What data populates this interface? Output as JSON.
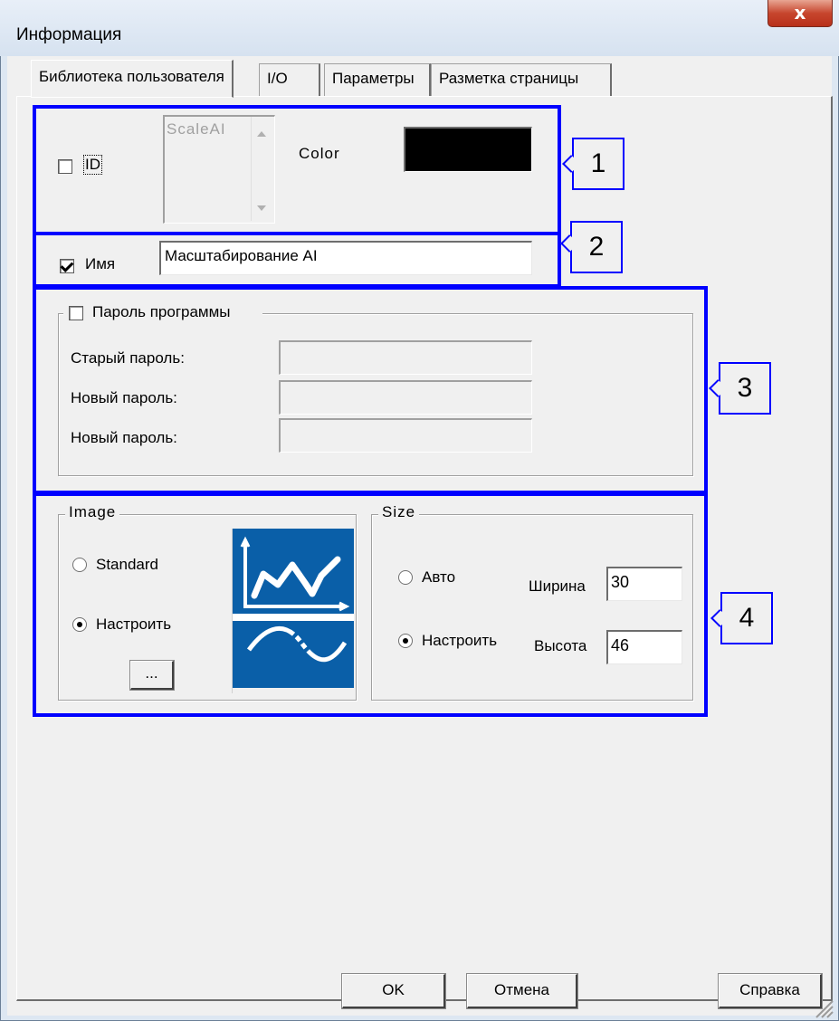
{
  "window": {
    "title": "Информация",
    "close_glyph": "x"
  },
  "tabs": [
    {
      "label": "Библиотека пользователя"
    },
    {
      "label": "I/O"
    },
    {
      "label": "Параметры"
    },
    {
      "label": "Разметка страницы"
    }
  ],
  "callouts": [
    "1",
    "2",
    "3",
    "4"
  ],
  "section_id": {
    "id_label": "ID",
    "id_checked": false,
    "list_items": [
      "ScaleAI"
    ],
    "color_label": "Color",
    "color_value": "#000000"
  },
  "section_name": {
    "name_label": "Имя",
    "name_checked": true,
    "name_value": "Масштабирование AI"
  },
  "section_password": {
    "group_label": "Пароль программы",
    "group_checked": false,
    "old_password_label": "Старый пароль:",
    "new_password_label": "Новый пароль:",
    "confirm_password_label": "Новый пароль:"
  },
  "section_image": {
    "group_label": "Image",
    "standard_label": "Standard",
    "custom_label": "Настроить",
    "selected": "custom",
    "browse_label": "...",
    "preview_bg": "#0a5fa8"
  },
  "section_size": {
    "group_label": "Size",
    "auto_label": "Авто",
    "custom_label": "Настроить",
    "selected": "custom",
    "width_label": "Ширина",
    "width_value": "30",
    "height_label": "Высота",
    "height_value": "46"
  },
  "buttons": {
    "ok": "OK",
    "cancel": "Отмена",
    "help": "Справка"
  }
}
